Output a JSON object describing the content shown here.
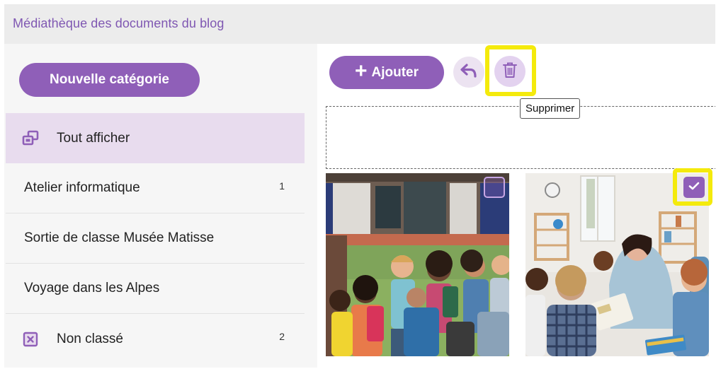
{
  "window": {
    "title": "Médiathèque des documents du blog"
  },
  "sidebar": {
    "new_category_label": "Nouvelle catégorie",
    "items": [
      {
        "label": "Tout afficher",
        "count": "",
        "icon": "show-all-icon",
        "active": true
      },
      {
        "label": "Atelier informatique",
        "count": "1",
        "icon": "",
        "active": false
      },
      {
        "label": "Sortie de classe Musée Matisse",
        "count": "",
        "icon": "",
        "active": false
      },
      {
        "label": "Voyage dans les Alpes",
        "count": "",
        "icon": "",
        "active": false
      },
      {
        "label": "Non classé",
        "count": "2",
        "icon": "uncategorized-icon",
        "active": false
      }
    ]
  },
  "toolbar": {
    "add_label": "Ajouter",
    "add_icon": "plus-icon",
    "undo_icon": "undo-icon",
    "delete_icon": "trash-icon",
    "delete_tooltip": "Supprimer"
  },
  "media": [
    {
      "id": "photo-schoolyard",
      "selected": false
    },
    {
      "id": "photo-classroom",
      "selected": true
    }
  ],
  "colors": {
    "accent": "#8f5fb8",
    "accent_light": "#e8dcee",
    "title_text": "#7f57b2",
    "highlight": "#f4ea0c",
    "titlebar_bg": "#ececec",
    "sidebar_bg": "#f6f6f6"
  }
}
